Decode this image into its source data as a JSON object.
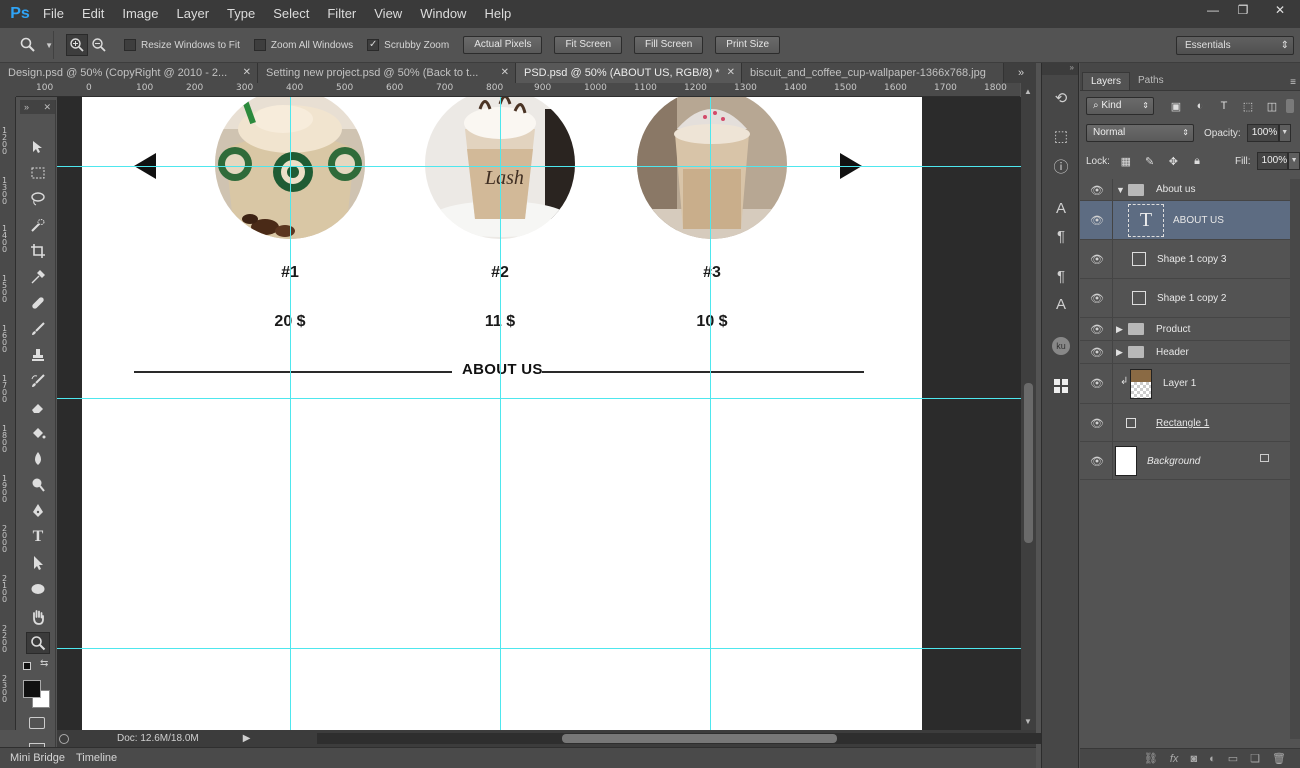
{
  "app": {
    "logo": "Ps",
    "menu": [
      "File",
      "Edit",
      "Image",
      "Layer",
      "Type",
      "Select",
      "Filter",
      "View",
      "Window",
      "Help"
    ],
    "window_controls": {
      "minimize": "—",
      "restore": "❐",
      "close": "✕"
    }
  },
  "options": {
    "resize_windows_label": "Resize Windows to Fit",
    "resize_windows_checked": false,
    "zoom_all_label": "Zoom All Windows",
    "zoom_all_checked": false,
    "scrubby_label": "Scrubby Zoom",
    "scrubby_checked": true,
    "buttons": [
      "Actual Pixels",
      "Fit Screen",
      "Fill Screen",
      "Print Size"
    ],
    "workspace": "Essentials"
  },
  "tabs": [
    {
      "label": "Design.psd @ 50% (CopyRight @ 2010 - 2...",
      "active": false
    },
    {
      "label": "Setting new project.psd @ 50% (Back to t...",
      "active": false
    },
    {
      "label": "PSD.psd @ 50% (ABOUT US, RGB/8) *",
      "active": true
    },
    {
      "label": "biscuit_and_coffee_cup-wallpaper-1366x768.jpg",
      "active": false
    }
  ],
  "ruler_top": [
    "100",
    "0",
    "100",
    "200",
    "300",
    "400",
    "500",
    "600",
    "700",
    "800",
    "900",
    "1000",
    "1100",
    "1200",
    "1300",
    "1400",
    "1500",
    "1600",
    "1700",
    "1800"
  ],
  "ruler_left": [
    "1200",
    "1300",
    "1400",
    "1500",
    "1600",
    "1700",
    "1800",
    "1900",
    "2000",
    "2100",
    "2200",
    "2300"
  ],
  "canvas": {
    "products": [
      {
        "label": "#1",
        "price": "20 $"
      },
      {
        "label": "#2",
        "price": "11 $"
      },
      {
        "label": "#3",
        "price": "10 $"
      }
    ],
    "section_title": "ABOUT US"
  },
  "status": {
    "doc_size": "Doc: 12.6M/18.0M"
  },
  "bottom_tabs": [
    "Mini Bridge",
    "Timeline"
  ],
  "layers_panel": {
    "tabs": [
      "Layers",
      "Paths"
    ],
    "filter_kind": "Kind",
    "blend_mode": "Normal",
    "opacity_label": "Opacity:",
    "opacity_value": "100%",
    "lock_label": "Lock:",
    "fill_label": "Fill:",
    "fill_value": "100%",
    "layers": [
      {
        "name": "About us",
        "type": "group-open"
      },
      {
        "name": "ABOUT US",
        "type": "text",
        "selected": true
      },
      {
        "name": "Shape 1 copy 3",
        "type": "shape"
      },
      {
        "name": "Shape 1 copy 2",
        "type": "shape"
      },
      {
        "name": "Product",
        "type": "group"
      },
      {
        "name": "Header",
        "type": "group"
      },
      {
        "name": "Layer 1",
        "type": "image"
      },
      {
        "name": "Rectangle 1",
        "type": "shape"
      },
      {
        "name": "Background",
        "type": "background"
      }
    ]
  },
  "colors": {
    "guide": "#4ee7ee",
    "selection": "#5d6c82",
    "ps_blue": "#2fa3f5"
  }
}
